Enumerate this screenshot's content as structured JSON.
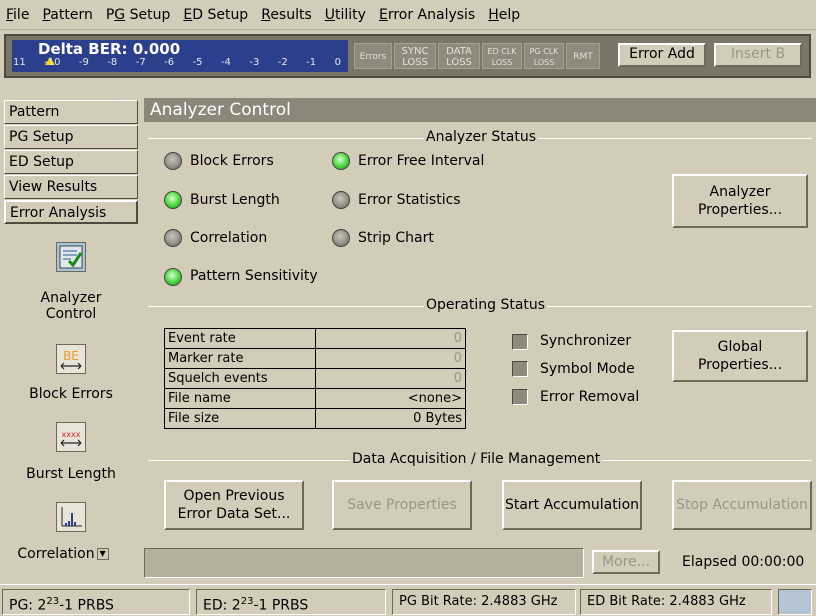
{
  "menu": [
    {
      "pre": "",
      "u": "F",
      "post": "ile"
    },
    {
      "pre": "",
      "u": "P",
      "post": "attern"
    },
    {
      "pre": "P",
      "u": "G",
      "post": " Setup"
    },
    {
      "pre": "",
      "u": "E",
      "post": "D Setup"
    },
    {
      "pre": "",
      "u": "R",
      "post": "esults"
    },
    {
      "pre": "",
      "u": "U",
      "post": "tility"
    },
    {
      "pre": "",
      "u": "E",
      "post": "rror Analysis"
    },
    {
      "pre": "",
      "u": "H",
      "post": "elp"
    }
  ],
  "ber": {
    "label": "Delta BER: 0.000",
    "scale": [
      "11",
      "-10",
      "-9",
      "-8",
      "-7",
      "-6",
      "-5",
      "-4",
      "-3",
      "-2",
      "-1",
      "0"
    ]
  },
  "indicators": {
    "errors": "Errors",
    "sync_loss": [
      "SYNC",
      "LOSS"
    ],
    "data_loss": [
      "DATA",
      "LOSS"
    ],
    "ed_clk_loss": [
      "ED CLK",
      "LOSS"
    ],
    "pg_clk_loss": [
      "PG CLK",
      "LOSS"
    ],
    "rmt": "RMT"
  },
  "header_buttons": {
    "error_add": "Error Add",
    "insert_b": "Insert B"
  },
  "nav": {
    "tabs": [
      "Pattern",
      "PG Setup",
      "ED Setup",
      "View Results",
      "Error Analysis"
    ],
    "icons": [
      {
        "label": "Analyzer Control",
        "line1": "Analyzer",
        "line2": "Control"
      },
      {
        "label": "Block Errors",
        "glyph": "BE"
      },
      {
        "label": "Burst Length",
        "glyph": "xxxx"
      },
      {
        "label": "Correlation"
      }
    ]
  },
  "panel": {
    "title": "Analyzer Control",
    "analyzer_status_title": "Analyzer Status",
    "analyzer_items": [
      {
        "label": "Block Errors",
        "on": false
      },
      {
        "label": "Burst Length",
        "on": true
      },
      {
        "label": "Correlation",
        "on": false
      },
      {
        "label": "Pattern Sensitivity",
        "on": true
      },
      {
        "label": "Error Free Interval",
        "on": true
      },
      {
        "label": "Error Statistics",
        "on": false
      },
      {
        "label": "Strip Chart",
        "on": false
      }
    ],
    "analyzer_properties_btn": [
      "Analyzer",
      "Properties..."
    ],
    "operating_status_title": "Operating Status",
    "operating_rows": [
      {
        "label": "Event rate",
        "value": "0",
        "dim": true
      },
      {
        "label": "Marker rate",
        "value": "0",
        "dim": true
      },
      {
        "label": "Squelch events",
        "value": "0",
        "dim": true
      },
      {
        "label": "File name",
        "value": "<none>",
        "dim": false
      },
      {
        "label": "File size",
        "value": "0 Bytes",
        "dim": false
      }
    ],
    "checkboxes": [
      "Synchronizer",
      "Symbol Mode",
      "Error Removal"
    ],
    "global_properties_btn": [
      "Global",
      "Properties..."
    ],
    "data_acq_title": "Data Acquisition / File Management",
    "buttons": {
      "open_previous": [
        "Open Previous",
        "Error Data Set..."
      ],
      "save_properties": "Save Properties",
      "start_accumulation": "Start Accumulation",
      "stop_accumulation": "Stop Accumulation"
    },
    "more_btn": "More...",
    "elapsed": "Elapsed 00:00:00"
  },
  "statusbar": {
    "pg_prefix": "PG: 2",
    "pg_sup": "23",
    "pg_suffix": "-1 PRBS",
    "ed_prefix": "ED: 2",
    "ed_sup": "23",
    "ed_suffix": "-1 PRBS",
    "pg_rate": "PG Bit Rate: 2.4883 GHz",
    "ed_rate": "ED Bit Rate: 2.4883 GHz"
  },
  "colors": {
    "background": "#d3ccb8",
    "ber_panel": "#2b3f8c",
    "led_on": "#4ad43c",
    "led_off": "#8f8c84",
    "title_bar": "#8c8778"
  }
}
